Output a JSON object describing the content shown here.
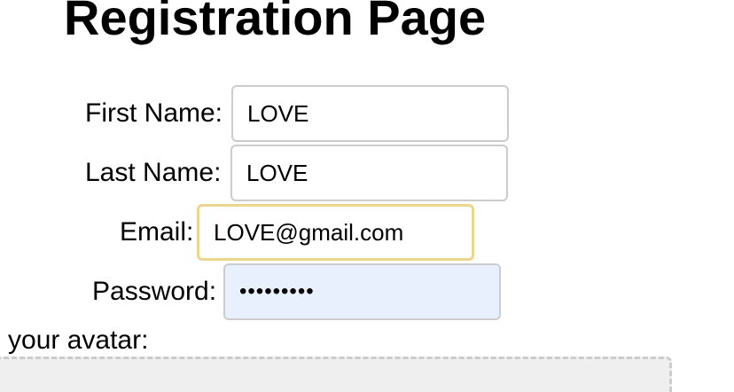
{
  "page": {
    "title": "Registration Page"
  },
  "form": {
    "first_name": {
      "label": "First Name:",
      "value": "LOVE"
    },
    "last_name": {
      "label": "Last Name:",
      "value": "LOVE"
    },
    "email": {
      "label": "Email:",
      "value": "LOVE@gmail.com",
      "focused": true
    },
    "password": {
      "label": "Password:",
      "value": "123456789",
      "autofilled": true
    },
    "avatar": {
      "label": "d your avatar:"
    }
  },
  "colors": {
    "focus_border": "#ecd58c",
    "autofill_background": "#e8f0fe",
    "input_border": "#cccccc",
    "dropzone_background": "#efefef"
  }
}
